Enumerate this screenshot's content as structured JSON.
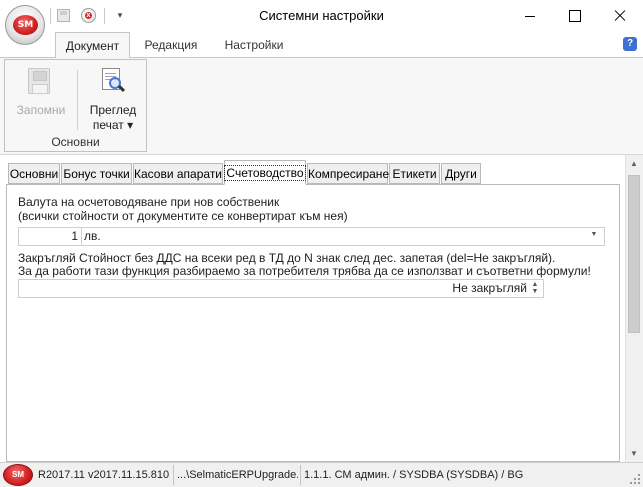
{
  "window": {
    "title": "Системни настройки",
    "app_logo": "SM"
  },
  "ribbon": {
    "tabs": [
      {
        "label": "Документ",
        "active": true
      },
      {
        "label": "Редакция",
        "active": false
      },
      {
        "label": "Настройки",
        "active": false
      }
    ],
    "help_icon": "?",
    "group": {
      "label": "Основни",
      "save_label": "Запомни",
      "save_enabled": false,
      "print_label_line1": "Преглед",
      "print_label_line2": "печат ▾"
    }
  },
  "content": {
    "tabs": [
      {
        "label": "Основни",
        "active": false
      },
      {
        "label": "Бонус точки",
        "active": false
      },
      {
        "label": "Касови апарати",
        "active": false
      },
      {
        "label": "Счетоводство",
        "active": true
      },
      {
        "label": "Компресиране",
        "active": false
      },
      {
        "label": "Етикети",
        "active": false
      },
      {
        "label": "Други",
        "active": false
      }
    ],
    "currency": {
      "label_line1": "Валута на осчетоводяване при нов собственик",
      "label_line2": "(всички стойности от документите се конвертират към нея)",
      "amount": "1",
      "selected": "лв."
    },
    "rounding": {
      "label_line1": "Закръгляй Стойност без ДДС на всеки ред в ТД до N знак след дес. запетая (del=Не закръгляй).",
      "label_line2": "За да работи тази функция разбираемо за потребителя трябва да се използват и съответни формули!",
      "value": "Не закръгляй"
    }
  },
  "statusbar": {
    "logo": "SM",
    "version": "R2017.11 v2017.11.15.810",
    "path": "...\\SelmaticERPUpgrade.",
    "user": "1.1.1. СМ админ. / SYSDBA (SYSDBA) / BG"
  },
  "icons": {
    "scroll_up": "▲",
    "scroll_down": "▼",
    "dropdown": "▼",
    "spin": "▲▼",
    "qat_customize": "▾",
    "close_mark": "x"
  }
}
